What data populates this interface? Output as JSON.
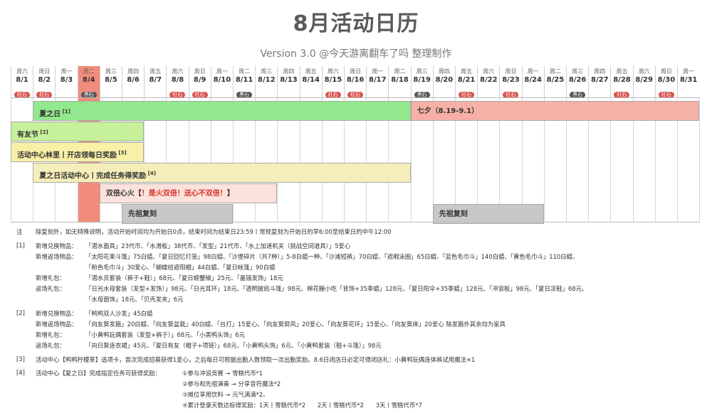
{
  "title": "8月活动日历",
  "subtitle": "Version 3.0 @今天游离翻车了吗 整理制作",
  "badges": {
    "red": "红石",
    "black": "黑石"
  },
  "days": [
    {
      "wk": "周六",
      "date": "8/1",
      "badge": "red"
    },
    {
      "wk": "周日",
      "date": "8/2",
      "badge": "red"
    },
    {
      "wk": "周一",
      "date": "8/3",
      "badge": ""
    },
    {
      "wk": "周二",
      "date": "8/4",
      "badge": "black"
    },
    {
      "wk": "周三",
      "date": "8/5",
      "badge": ""
    },
    {
      "wk": "周四",
      "date": "8/6",
      "badge": ""
    },
    {
      "wk": "周五",
      "date": "8/7",
      "badge": ""
    },
    {
      "wk": "周六",
      "date": "8/8",
      "badge": "red"
    },
    {
      "wk": "周日",
      "date": "8/9",
      "badge": "red"
    },
    {
      "wk": "周一",
      "date": "8/10",
      "badge": ""
    },
    {
      "wk": "周二",
      "date": "8/11",
      "badge": "black"
    },
    {
      "wk": "周三",
      "date": "8/12",
      "badge": ""
    },
    {
      "wk": "周四",
      "date": "8/13",
      "badge": ""
    },
    {
      "wk": "周五",
      "date": "8/14",
      "badge": ""
    },
    {
      "wk": "周六",
      "date": "8/15",
      "badge": "red"
    },
    {
      "wk": "周日",
      "date": "8/16",
      "badge": "red"
    },
    {
      "wk": "周一",
      "date": "8/17",
      "badge": ""
    },
    {
      "wk": "周二",
      "date": "8/18",
      "badge": ""
    },
    {
      "wk": "周三",
      "date": "8/19",
      "badge": "black"
    },
    {
      "wk": "周四",
      "date": "8/20",
      "badge": ""
    },
    {
      "wk": "周五",
      "date": "8/21",
      "badge": "red"
    },
    {
      "wk": "周六",
      "date": "8/22",
      "badge": ""
    },
    {
      "wk": "周日",
      "date": "8/23",
      "badge": "red"
    },
    {
      "wk": "周一",
      "date": "8/24",
      "badge": ""
    },
    {
      "wk": "周二",
      "date": "8/25",
      "badge": ""
    },
    {
      "wk": "周三",
      "date": "8/26",
      "badge": "black"
    },
    {
      "wk": "周四",
      "date": "8/27",
      "badge": ""
    },
    {
      "wk": "周五",
      "date": "8/28",
      "badge": "red"
    },
    {
      "wk": "周六",
      "date": "8/29",
      "badge": ""
    },
    {
      "wk": "周日",
      "date": "8/30",
      "badge": "red"
    },
    {
      "wk": "周一",
      "date": "8/31",
      "badge": ""
    }
  ],
  "today_day": 4,
  "events": [
    {
      "name": "summer-day-bar",
      "label": "夏之日",
      "ref": "[1]",
      "start": 2,
      "end": 18,
      "row": 0,
      "color": "#92e88c"
    },
    {
      "name": "qixi-bar",
      "label": "七夕（8.19-9.1）",
      "ref": "",
      "start": 19,
      "end": 31,
      "row": 0,
      "color": "#f6b0a5"
    },
    {
      "name": "friends-festival-bar",
      "label": "有友节",
      "ref": "[2]",
      "start": 1,
      "end": 6,
      "row": 1,
      "color": "#c7f09a"
    },
    {
      "name": "activity-center-linli-bar",
      "label": "活动中心林里丨开店领每日奖励",
      "ref": "[3]",
      "start": 1,
      "end": 6,
      "row": 2,
      "color": "#f7f0a6"
    },
    {
      "name": "summer-activity-center-bar",
      "label": "夏之日活动中心丨完成任务得奖励",
      "ref": "[4]",
      "start": 2,
      "end": 18,
      "row": 3,
      "color": "#f6eeb8"
    },
    {
      "name": "double-heart-fire-bar",
      "label": "双倍心火【",
      "warn": "！是火双倍！送心不双倍！",
      "tail": "】",
      "ref": "",
      "start": 5,
      "end": 12,
      "row": 4,
      "color": "#fbe2dc"
    },
    {
      "name": "ancestor-rerun-bar-1",
      "label": "先祖复刻",
      "ref": "",
      "start": 6,
      "end": 10,
      "row": 5,
      "color": "#c8c8c8"
    },
    {
      "name": "ancestor-rerun-bar-2",
      "label": "先祖复刻",
      "ref": "",
      "start": 20,
      "end": 24,
      "row": 5,
      "color": "#c8c8c8"
    }
  ],
  "notes": {
    "note_tag": "注",
    "note_text": "除复刻外，如无特殊说明，活动开始时间均为开始日0点，结束时间为结束日23:59丨常规复刻为开始日的早6:00至结束日的中午12:00",
    "s1": {
      "tag": "[1]",
      "items_label": "新增兑换物品：",
      "items": "「潜水面具」23代币、「水滑板」38代币、「发型」21代币、「水上加速机关（挑战空间道具）」5爱心",
      "return_label": "新增返场物品：",
      "return1": "「太阳花束斗篷」75白蜡、「夏日回忆灯笼」98白蜡、「沙堡碎片（共7种）」5-8白蜡一种、「沙滩短裤」70白蜡、「遮暇泳圈」65白蜡、「蓝色毛巾斗」140白蜡、「黄色毛巾斗」110白蜡、",
      "return2": "「粉色毛巾斗」30爱心、「蝴蝶结遮阳帽」44白蜡、「夏日帐篷」90白蜡",
      "gift_label": "新增礼包：",
      "gift": "「潜水员套装（裤子+鞋）」68元、「夏日螃蟹椒」25元、「墨镜发饰」18元",
      "retgift_label": "返场礼包：",
      "retgift1": "「日光水母套装（发型+发饰）」98元、「日光耳环」18元、「透明披肩斗篷」98元、棉花糖小吃「背饰+35季蜡」128元、「夏日阳伞+35季蜡」128元、「冲浪板」98元、「夏日凉鞋」68元、",
      "retgift2": "「水母面饰」18元、「贝壳发夹」6元"
    },
    "s2": {
      "tag": "[2]",
      "items_label": "新增兑换物品：",
      "items": "「鸭鸭双人沙发」45白蜡",
      "return_label": "新增返场物品：",
      "return1": "「向友葵发箍」20白蜡、「向友葵盆栽」40白蜡、「台灯」15爱心、「向友葵屏风」20爱心、「向友葵花环」15爱心、「向友葵床」20爱心 除发箍外其余均为家具",
      "gift_label": "新增礼包：",
      "gift": "「小黄鸭玩偶套装（发型+裤子）」68元、「小黑鸭头饰」6元",
      "retgift_label": "返场礼包：",
      "retgift1": "「向日葵连衣裙」45元、「夏日有友（帽子+项链）」68元、「小黄鸭头饰」6元、「小黄鸭套装（鞋+斗篷）」98元"
    },
    "s3": {
      "tag": "[3]",
      "text": "活动中心【鸭鸭柠檬茶】选项卡，首次完成招募获得1爱心，之后每日可根据出勤人数领取一次出勤奖励。8.6日闭店日必定可得闭店礼：小黄鸭玩偶连体裤试用魔法×1"
    },
    "s4": {
      "tag": "[4]",
      "text": "活动中心【夏之日】完成指定任务可获得奖励：",
      "line1": "①参与冲浪竞赛 → 雪糕代币*1",
      "line2": "②参与和先祖演奏 → 分享音符魔法*2",
      "line3": "③摊位享用饮料 → 元气满满*2。",
      "line4": "④累计登录天数达标得奖励：1天丨雪糕代币*2　　2天丨雪糕代币*2　　3天丨雪糕代币*7"
    }
  }
}
